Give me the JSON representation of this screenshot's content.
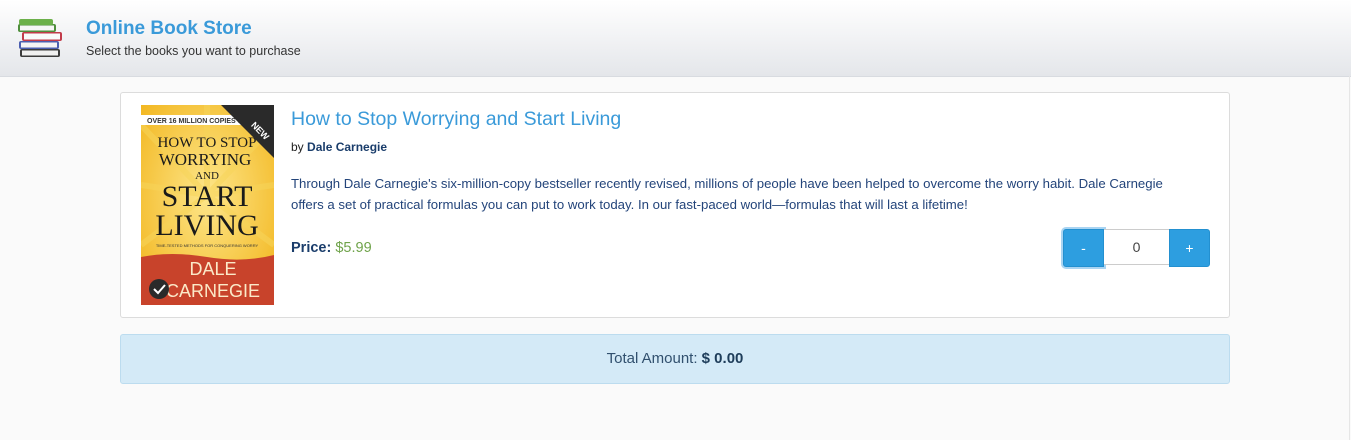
{
  "header": {
    "title": "Online Book Store",
    "subtitle": "Select the books you want to purchase",
    "logo_icon": "books-stack-icon"
  },
  "book": {
    "title": "How to Stop Worrying and Start Living",
    "by_prefix": "by",
    "author": "Dale Carnegie",
    "description": "Through Dale Carnegie's six-million-copy bestseller recently revised, millions of people have been helped to overcome the worry habit. Dale Carnegie offers a set of practical formulas you can put to work today. In our fast-paced world—formulas that will last a lifetime!",
    "price_label": "Price:",
    "price_value": "$5.99",
    "cover": {
      "banner": "OVER 16 MILLION COPIES SOLD",
      "line1": "HOW TO STOP",
      "line2": "WORRYING",
      "line3": "AND",
      "line4": "START",
      "line5": "LIVING",
      "tagline": "TIME-TESTED METHODS FOR CONQUERING WORRY",
      "corner": "NEW",
      "author_line1": "DALE",
      "author_line2": "CARNEGIE"
    },
    "quantity": {
      "minus_label": "-",
      "value": "0",
      "plus_label": "+"
    }
  },
  "total": {
    "label": "Total Amount:",
    "value": "$ 0.00"
  },
  "colors": {
    "accent": "#3a9ad9",
    "button": "#2d9ee0",
    "price": "#6fa34a",
    "total_bg": "#d4eaf7"
  }
}
